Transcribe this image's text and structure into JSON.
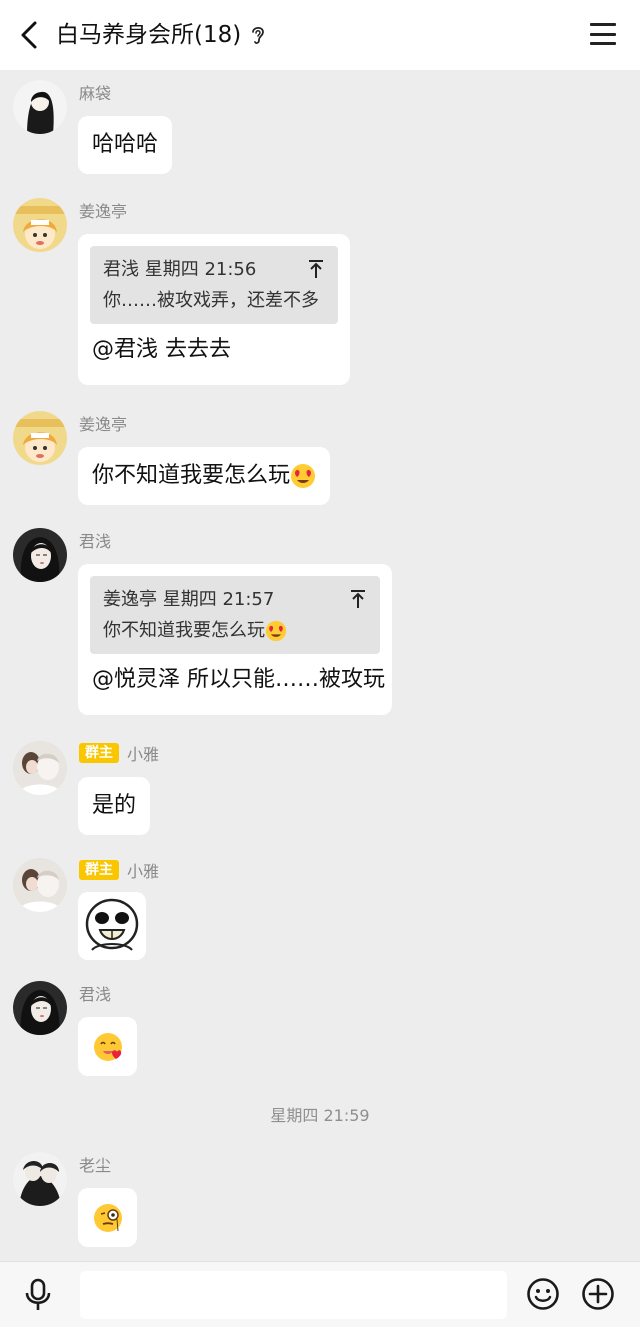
{
  "header": {
    "title": "白马养身会所(18)"
  },
  "messages": [
    {
      "sender": "麻袋",
      "text": "哈哈哈"
    },
    {
      "sender": "姜逸亭",
      "quote_header": "君浅 星期四 21:56",
      "quote_text": "你……被攻戏弄，还差不多",
      "text": "@君浅 去去去"
    },
    {
      "sender": "姜逸亭",
      "text": "你不知道我要怎么玩"
    },
    {
      "sender": "君浅",
      "quote_header": "姜逸亭 星期四 21:57",
      "quote_text": "你不知道我要怎么玩",
      "text": "@悦灵泽 所以只能……被攻玩"
    },
    {
      "badge": "群主",
      "sender": "小雅",
      "text": "是的"
    },
    {
      "badge": "群主",
      "sender": "小雅",
      "sticker": "laughing-face-sticker"
    },
    {
      "sender": "君浅",
      "emoji": "heart-tongue-emoji"
    },
    {
      "sender": "老尘",
      "emoji": "monocle-emoji"
    }
  ],
  "timestamp": "星期四 21:59",
  "icons": {
    "back": "chevron-left-icon",
    "ear": "ear-icon",
    "menu": "hamburger-menu-icon",
    "pin": "pin-top-icon",
    "voice": "microphone-icon",
    "emoji": "smiley-icon",
    "plus": "plus-circle-icon"
  },
  "colors": {
    "chat_background": "#ededed",
    "bubble": "#ffffff",
    "owner_badge": "#f9c600",
    "quote_background": "#e3e3e3"
  }
}
